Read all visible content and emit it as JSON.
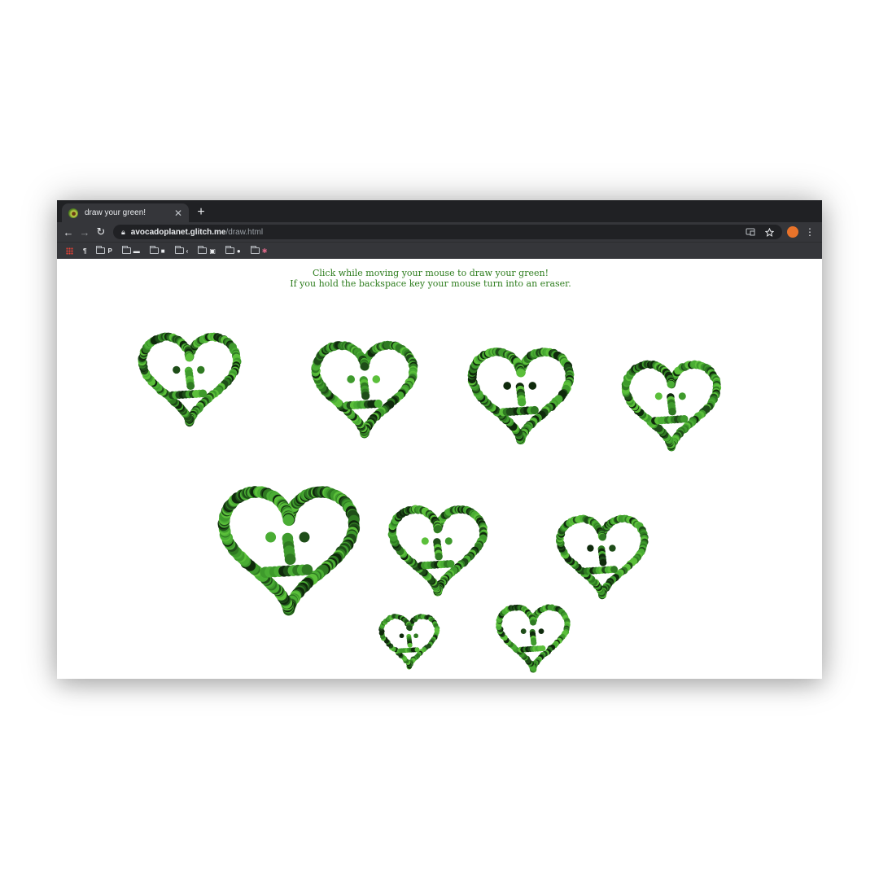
{
  "browser": {
    "tab": {
      "title": "draw your green!",
      "favicon": "avocado-icon",
      "close_glyph": "✕"
    },
    "new_tab_glyph": "+",
    "nav": {
      "back": "←",
      "forward": "→",
      "reload": "↻"
    },
    "url": {
      "host": "avocadoplanet.glitch.me",
      "path": "/draw.html"
    },
    "icons": [
      "lock-icon",
      "cast-icon",
      "star-icon",
      "profile-avatar",
      "menu-icon"
    ],
    "bookmarks": [
      {
        "icon": "apps-grid-icon",
        "glyph": ""
      },
      {
        "icon": "bookmark-favicon",
        "glyph": "¶"
      },
      {
        "icon": "folder-icon",
        "glyph": "P"
      },
      {
        "icon": "folder-icon",
        "glyph": "▬"
      },
      {
        "icon": "folder-icon",
        "glyph": "■"
      },
      {
        "icon": "folder-icon",
        "glyph": "‹"
      },
      {
        "icon": "folder-icon",
        "glyph": "▣"
      },
      {
        "icon": "folder-icon",
        "glyph": "●"
      },
      {
        "icon": "folder-icon",
        "glyph": "✱"
      }
    ]
  },
  "page": {
    "line1": "Click while moving your mouse to draw your green!",
    "line2": "If you hold the backspace key your mouse turn into an eraser."
  },
  "palette": [
    "#1e4d18",
    "#2f7a22",
    "#3e9a2c",
    "#5bbf3a",
    "#0f2a0c",
    "#4aad34"
  ],
  "drawing": {
    "hearts": [
      {
        "name": "heart-face-1",
        "scale": 1.0
      },
      {
        "name": "heart-face-2",
        "scale": 1.0
      },
      {
        "name": "heart-face-3",
        "scale": 1.0
      },
      {
        "name": "heart-face-4",
        "scale": 0.9
      },
      {
        "name": "heart-face-5",
        "scale": 1.25
      },
      {
        "name": "heart-face-6",
        "scale": 0.9
      },
      {
        "name": "heart-face-7",
        "scale": 0.85
      },
      {
        "name": "heart-face-8",
        "scale": 0.55
      },
      {
        "name": "heart-face-9",
        "scale": 0.7
      }
    ]
  }
}
